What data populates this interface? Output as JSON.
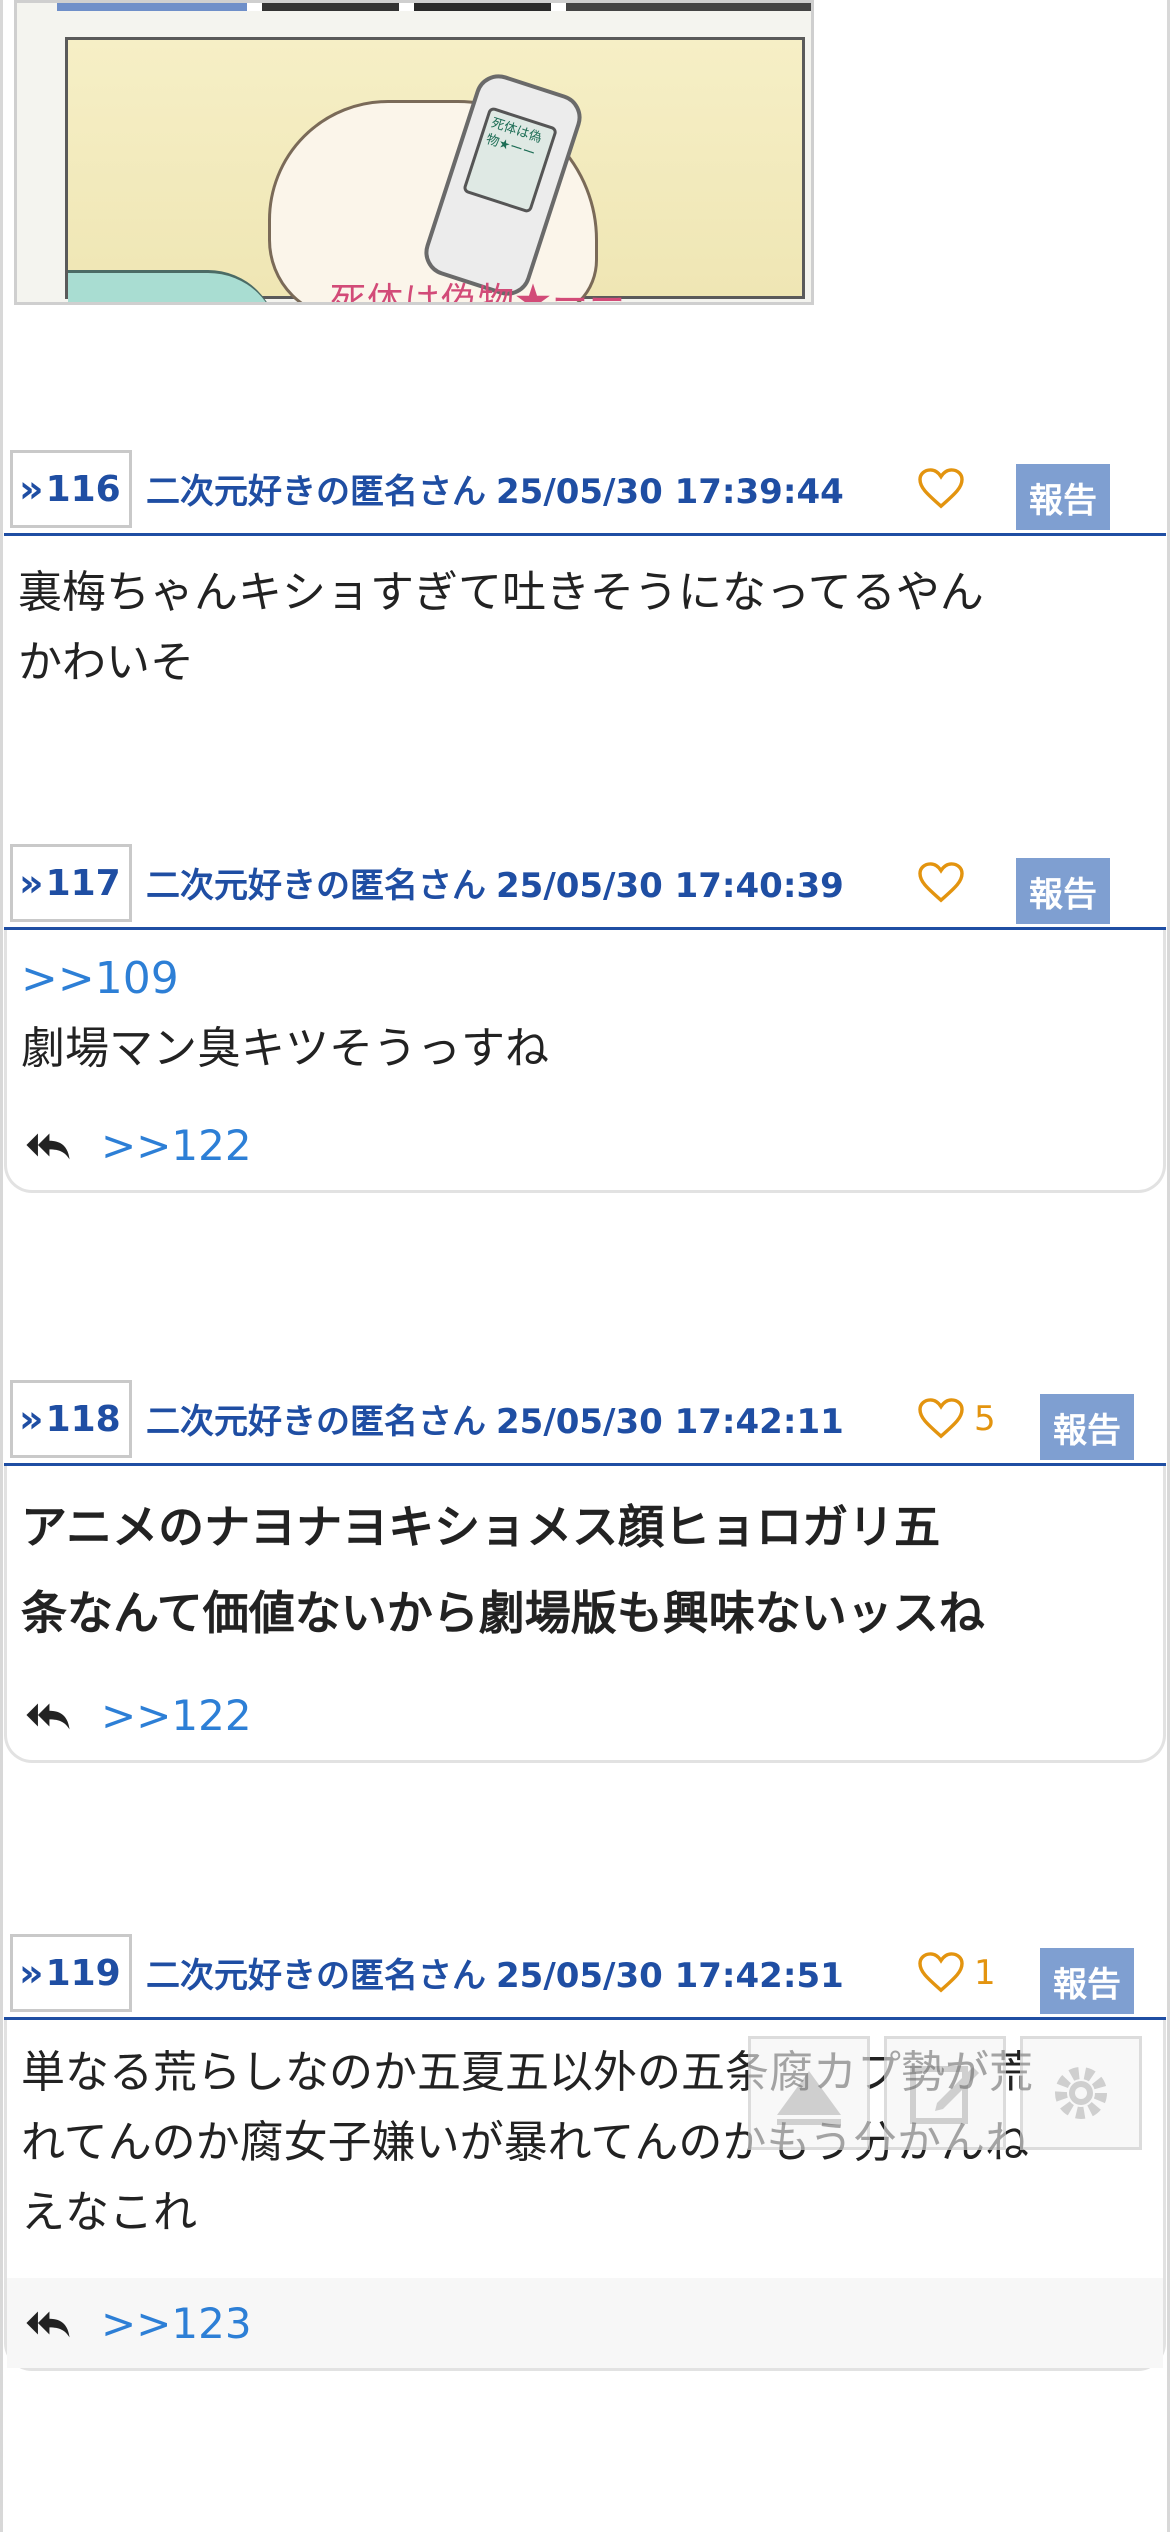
{
  "image_post": {
    "image_caption": "死体は偽物★ーー",
    "phone_text": "死体は偽物★ーー",
    "icon": "manga-image"
  },
  "colors": {
    "accent": "#1f4ea3",
    "like": "#e3940f",
    "report_bg": "#7f9fd1",
    "anchor": "#2d7fd6"
  },
  "posts": [
    {
      "number": "116",
      "name": "二次元好きの匿名さん",
      "timestamp": "25/05/30 17:39:44",
      "likes": "",
      "report_label": "報告",
      "lines": [
        "裏梅ちゃんキショすぎて吐きそうになってるやん",
        "かわいそ"
      ]
    },
    {
      "number": "117",
      "name": "二次元好きの匿名さん",
      "timestamp": "25/05/30 17:40:39",
      "likes": "",
      "report_label": "報告",
      "anchor": ">>109",
      "lines": [
        "劇場マン臭キツそうっすね"
      ],
      "reply": ">>122"
    },
    {
      "number": "118",
      "name": "二次元好きの匿名さん",
      "timestamp": "25/05/30 17:42:11",
      "likes": "5",
      "report_label": "報告",
      "lines": [
        "アニメのナヨナヨキショメス顔ヒョロガリ五",
        "条なんて価値ないから劇場版も興味ないッスね"
      ],
      "reply": ">>122"
    },
    {
      "number": "119",
      "name": "二次元好きの匿名さん",
      "timestamp": "25/05/30 17:42:51",
      "likes": "1",
      "report_label": "報告",
      "lines": [
        "単なる荒らしなのか五夏五以外の五条腐カプ勢が荒",
        "れてんのか腐女子嫌いが暴れてんのかもう分かんね",
        "えなこれ"
      ],
      "reply": ">>123"
    }
  ],
  "floating_buttons": [
    "scroll-top",
    "compose",
    "settings"
  ]
}
